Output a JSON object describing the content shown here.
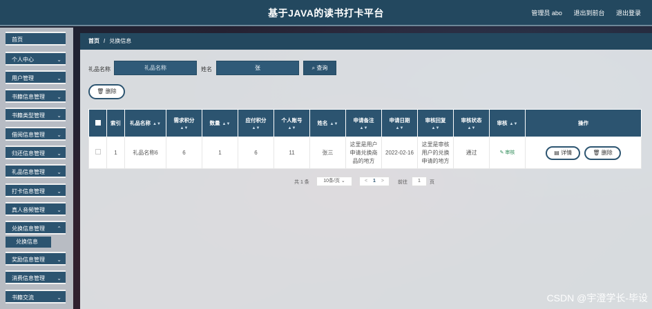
{
  "header": {
    "title": "基于JAVA的读书打卡平台",
    "admin": "管理员 abo",
    "back_to_front": "退出到前台",
    "logout": "退出登录"
  },
  "sidebar": {
    "items": [
      {
        "label": "首页",
        "chevron": false
      },
      {
        "label": "个人中心",
        "chevron": true
      },
      {
        "label": "用户管理",
        "chevron": true
      },
      {
        "label": "书籍信息管理",
        "chevron": true
      },
      {
        "label": "书籍类型管理",
        "chevron": true
      },
      {
        "label": "借阅信息管理",
        "chevron": true
      },
      {
        "label": "归还信息管理",
        "chevron": true
      },
      {
        "label": "礼品信息管理",
        "chevron": true
      },
      {
        "label": "打卡信息管理",
        "chevron": true
      },
      {
        "label": "真人音频管理",
        "chevron": true
      },
      {
        "label": "兑换信息管理",
        "chevron": true
      },
      {
        "label": "奖励信息管理",
        "chevron": true
      },
      {
        "label": "消费信息管理",
        "chevron": true
      },
      {
        "label": "书籍交流",
        "chevron": true
      }
    ],
    "active_sub": "兑换信息"
  },
  "breadcrumb": {
    "home": "首页",
    "sep": "/",
    "current": "兑换信息"
  },
  "search": {
    "gift_label": "礼品名称",
    "gift_placeholder": "礼品名称",
    "name_label": "姓名",
    "name_value": "张",
    "query_label": "查询",
    "delete_label": "删除"
  },
  "table": {
    "headers": [
      "",
      "索引",
      "礼品名称",
      "需求积分",
      "数量",
      "应付积分",
      "个人账号",
      "姓名",
      "申请备注",
      "申请日期",
      "审核回复",
      "审核状态",
      "审核",
      "操作"
    ],
    "rows": [
      {
        "index": "1",
        "gift": "礼品名称6",
        "need_points": "6",
        "qty": "1",
        "pay_points": "6",
        "account": "11",
        "name": "张三",
        "remark": "这里是用户申请兑换商品的地方",
        "date": "2022-02-16",
        "reply": "这里是审核用户的兑换申请的地方",
        "status": "通过",
        "audit": "审核",
        "detail": "详情",
        "delete": "删除"
      }
    ]
  },
  "pagination": {
    "total": "共 1 条",
    "page_size": "10条/页",
    "prev": "<",
    "current": "1",
    "next": ">",
    "goto_label": "前往",
    "goto_value": "1",
    "page_suffix": "页"
  },
  "watermark": "CSDN @宇澄学长-毕设",
  "colors": {
    "primary": "#2c5470",
    "header": "#23485f",
    "success": "#2e8b57"
  }
}
